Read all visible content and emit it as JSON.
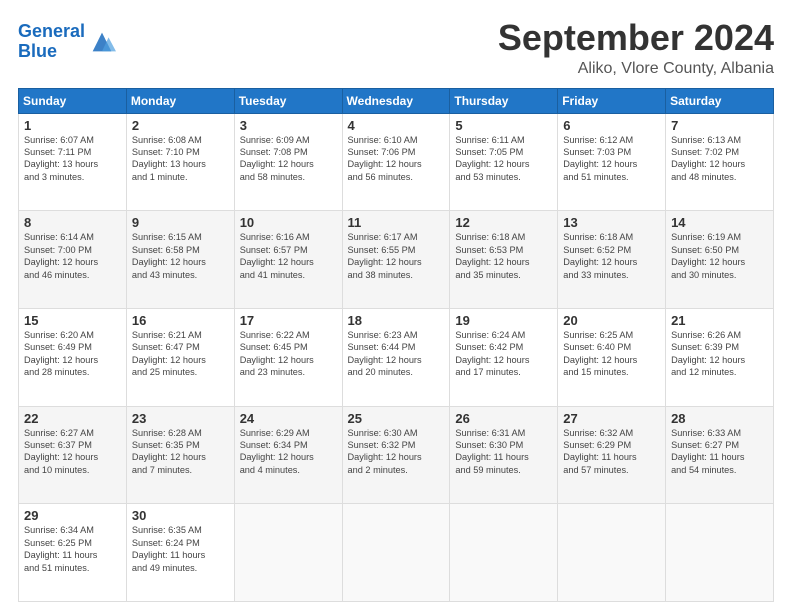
{
  "header": {
    "logo_line1": "General",
    "logo_line2": "Blue",
    "month": "September 2024",
    "location": "Aliko, Vlore County, Albania"
  },
  "weekdays": [
    "Sunday",
    "Monday",
    "Tuesday",
    "Wednesday",
    "Thursday",
    "Friday",
    "Saturday"
  ],
  "weeks": [
    [
      {
        "day": "1",
        "info": "Sunrise: 6:07 AM\nSunset: 7:11 PM\nDaylight: 13 hours\nand 3 minutes."
      },
      {
        "day": "2",
        "info": "Sunrise: 6:08 AM\nSunset: 7:10 PM\nDaylight: 13 hours\nand 1 minute."
      },
      {
        "day": "3",
        "info": "Sunrise: 6:09 AM\nSunset: 7:08 PM\nDaylight: 12 hours\nand 58 minutes."
      },
      {
        "day": "4",
        "info": "Sunrise: 6:10 AM\nSunset: 7:06 PM\nDaylight: 12 hours\nand 56 minutes."
      },
      {
        "day": "5",
        "info": "Sunrise: 6:11 AM\nSunset: 7:05 PM\nDaylight: 12 hours\nand 53 minutes."
      },
      {
        "day": "6",
        "info": "Sunrise: 6:12 AM\nSunset: 7:03 PM\nDaylight: 12 hours\nand 51 minutes."
      },
      {
        "day": "7",
        "info": "Sunrise: 6:13 AM\nSunset: 7:02 PM\nDaylight: 12 hours\nand 48 minutes."
      }
    ],
    [
      {
        "day": "8",
        "info": "Sunrise: 6:14 AM\nSunset: 7:00 PM\nDaylight: 12 hours\nand 46 minutes."
      },
      {
        "day": "9",
        "info": "Sunrise: 6:15 AM\nSunset: 6:58 PM\nDaylight: 12 hours\nand 43 minutes."
      },
      {
        "day": "10",
        "info": "Sunrise: 6:16 AM\nSunset: 6:57 PM\nDaylight: 12 hours\nand 41 minutes."
      },
      {
        "day": "11",
        "info": "Sunrise: 6:17 AM\nSunset: 6:55 PM\nDaylight: 12 hours\nand 38 minutes."
      },
      {
        "day": "12",
        "info": "Sunrise: 6:18 AM\nSunset: 6:53 PM\nDaylight: 12 hours\nand 35 minutes."
      },
      {
        "day": "13",
        "info": "Sunrise: 6:18 AM\nSunset: 6:52 PM\nDaylight: 12 hours\nand 33 minutes."
      },
      {
        "day": "14",
        "info": "Sunrise: 6:19 AM\nSunset: 6:50 PM\nDaylight: 12 hours\nand 30 minutes."
      }
    ],
    [
      {
        "day": "15",
        "info": "Sunrise: 6:20 AM\nSunset: 6:49 PM\nDaylight: 12 hours\nand 28 minutes."
      },
      {
        "day": "16",
        "info": "Sunrise: 6:21 AM\nSunset: 6:47 PM\nDaylight: 12 hours\nand 25 minutes."
      },
      {
        "day": "17",
        "info": "Sunrise: 6:22 AM\nSunset: 6:45 PM\nDaylight: 12 hours\nand 23 minutes."
      },
      {
        "day": "18",
        "info": "Sunrise: 6:23 AM\nSunset: 6:44 PM\nDaylight: 12 hours\nand 20 minutes."
      },
      {
        "day": "19",
        "info": "Sunrise: 6:24 AM\nSunset: 6:42 PM\nDaylight: 12 hours\nand 17 minutes."
      },
      {
        "day": "20",
        "info": "Sunrise: 6:25 AM\nSunset: 6:40 PM\nDaylight: 12 hours\nand 15 minutes."
      },
      {
        "day": "21",
        "info": "Sunrise: 6:26 AM\nSunset: 6:39 PM\nDaylight: 12 hours\nand 12 minutes."
      }
    ],
    [
      {
        "day": "22",
        "info": "Sunrise: 6:27 AM\nSunset: 6:37 PM\nDaylight: 12 hours\nand 10 minutes."
      },
      {
        "day": "23",
        "info": "Sunrise: 6:28 AM\nSunset: 6:35 PM\nDaylight: 12 hours\nand 7 minutes."
      },
      {
        "day": "24",
        "info": "Sunrise: 6:29 AM\nSunset: 6:34 PM\nDaylight: 12 hours\nand 4 minutes."
      },
      {
        "day": "25",
        "info": "Sunrise: 6:30 AM\nSunset: 6:32 PM\nDaylight: 12 hours\nand 2 minutes."
      },
      {
        "day": "26",
        "info": "Sunrise: 6:31 AM\nSunset: 6:30 PM\nDaylight: 11 hours\nand 59 minutes."
      },
      {
        "day": "27",
        "info": "Sunrise: 6:32 AM\nSunset: 6:29 PM\nDaylight: 11 hours\nand 57 minutes."
      },
      {
        "day": "28",
        "info": "Sunrise: 6:33 AM\nSunset: 6:27 PM\nDaylight: 11 hours\nand 54 minutes."
      }
    ],
    [
      {
        "day": "29",
        "info": "Sunrise: 6:34 AM\nSunset: 6:25 PM\nDaylight: 11 hours\nand 51 minutes."
      },
      {
        "day": "30",
        "info": "Sunrise: 6:35 AM\nSunset: 6:24 PM\nDaylight: 11 hours\nand 49 minutes."
      },
      {
        "day": "",
        "info": ""
      },
      {
        "day": "",
        "info": ""
      },
      {
        "day": "",
        "info": ""
      },
      {
        "day": "",
        "info": ""
      },
      {
        "day": "",
        "info": ""
      }
    ]
  ]
}
